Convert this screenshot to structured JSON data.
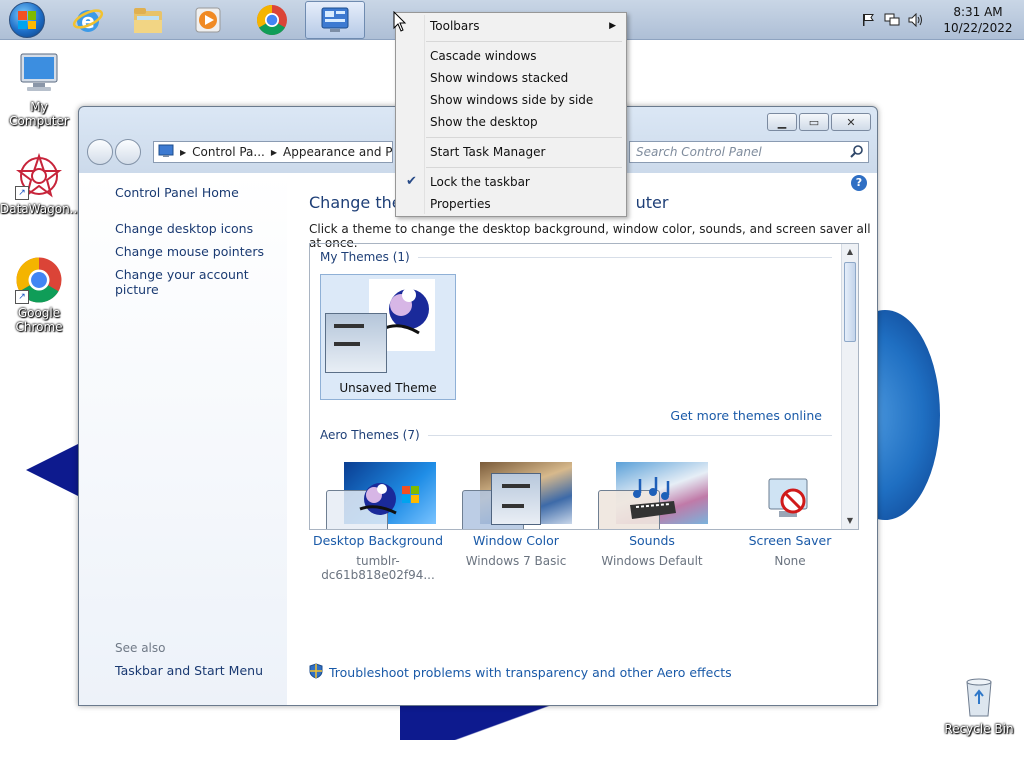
{
  "taskbar": {
    "clock_time": "8:31 AM",
    "clock_date": "10/22/2022",
    "icons": [
      "start-orb",
      "internet-explorer-icon",
      "file-explorer-icon",
      "media-player-icon",
      "chrome-icon",
      "control-panel-icon"
    ]
  },
  "desktop": {
    "icons": [
      {
        "label": "My Computer"
      },
      {
        "label": "DataWagon..."
      },
      {
        "label": "Google Chrome"
      },
      {
        "label": "Recycle Bin"
      }
    ]
  },
  "window": {
    "breadcrumb": [
      "Control Pa...",
      "Appearance and Pers"
    ],
    "search_placeholder": "Search Control Panel",
    "sidebar": {
      "home": "Control Panel Home",
      "links": [
        "Change desktop icons",
        "Change mouse pointers",
        "Change your account picture"
      ],
      "see_also": "See also",
      "see_also_link": "Taskbar and Start Menu"
    },
    "heading_left": "Change the",
    "heading_right": "uter",
    "subheading": "Click a theme to change the desktop background, window color, sounds, and screen saver all at once.",
    "my_themes_header": "My Themes (1)",
    "unsaved_theme": "Unsaved Theme",
    "get_more_themes": "Get more themes online",
    "aero_themes_header": "Aero Themes (7)",
    "bottom": [
      {
        "label": "Desktop Background",
        "value": "tumblr-dc61b818e02f94..."
      },
      {
        "label": "Window Color",
        "value": "Windows 7 Basic"
      },
      {
        "label": "Sounds",
        "value": "Windows Default"
      },
      {
        "label": "Screen Saver",
        "value": "None"
      }
    ],
    "troubleshoot": "Troubleshoot problems with transparency and other Aero effects"
  },
  "context_menu": {
    "toolbars": "Toolbars",
    "cascade": "Cascade windows",
    "stacked": "Show windows stacked",
    "side_by_side": "Show windows side by side",
    "show_desktop": "Show the desktop",
    "task_manager": "Start Task Manager",
    "lock_taskbar": "Lock the taskbar",
    "properties": "Properties"
  }
}
